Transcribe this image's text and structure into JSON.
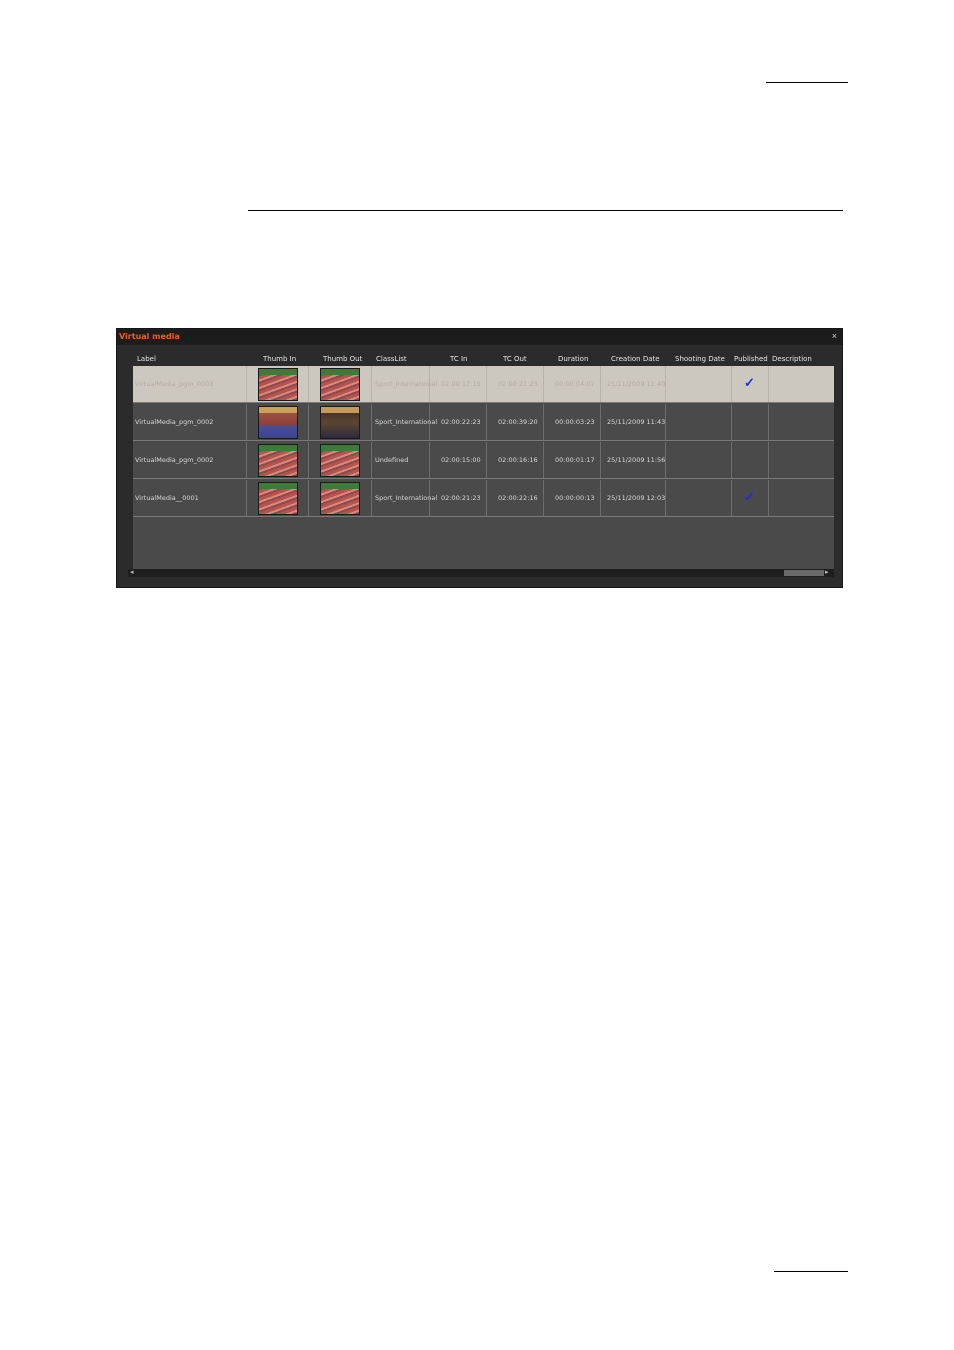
{
  "window": {
    "title": "Virtual media",
    "close_glyph": "×"
  },
  "columns": {
    "label": "Label",
    "thumb_in": "Thumb In",
    "thumb_out": "Thumb Out",
    "classlist": "ClassList",
    "tc_in": "TC In",
    "tc_out": "TC Out",
    "duration": "Duration",
    "creation_date": "Creation Date",
    "shooting_date": "Shooting Date",
    "published": "Published",
    "description": "Description"
  },
  "rows": [
    {
      "label": "VirtualMedia_pgm_0003",
      "thumb_in": "stadium-crowd-thumbnail",
      "thumb_out": "stadium-crowd-thumbnail",
      "classlist": "Sport_International",
      "tc_in": "02:00:17:15",
      "tc_out": "02:00:21:23",
      "duration": "00:00:04:07",
      "creation_date": "25/11/2009 11:40",
      "shooting_date": "",
      "published": "✓",
      "description": "",
      "selected": true
    },
    {
      "label": "VirtualMedia_pgm_0002",
      "thumb_in": "pole-vault-thumbnail",
      "thumb_out": "athlete-thumbnail",
      "classlist": "Sport_International",
      "tc_in": "02:00:22:23",
      "tc_out": "02:00:39:20",
      "duration": "00:00:03:23",
      "creation_date": "25/11/2009 11:43",
      "shooting_date": "",
      "published": "",
      "description": "",
      "selected": false
    },
    {
      "label": "VirtualMedia_pgm_0002",
      "thumb_in": "stadium-crowd-thumbnail",
      "thumb_out": "stadium-crowd-thumbnail",
      "classlist": "Undefined",
      "tc_in": "02:00:15:00",
      "tc_out": "02:00:16:16",
      "duration": "00:00:01:17",
      "creation_date": "25/11/2009 11:56",
      "shooting_date": "",
      "published": "",
      "description": "",
      "selected": false
    },
    {
      "label": "VirtualMedia__0001",
      "thumb_in": "stadium-crowd-thumbnail",
      "thumb_out": "stadium-crowd-thumbnail",
      "classlist": "Sport_International",
      "tc_in": "02:00:21:23",
      "tc_out": "02:00:22:16",
      "duration": "00:00:00:13",
      "creation_date": "25/11/2009 12:03",
      "shooting_date": "",
      "published": "✓",
      "description": "",
      "selected": false
    }
  ],
  "scrollbar": {
    "left_arrow": "◂",
    "right_arrow": "▸"
  },
  "colors": {
    "title": "#e8611c",
    "check": "#1d2fd6",
    "selected_row": "#cdc8bf"
  }
}
